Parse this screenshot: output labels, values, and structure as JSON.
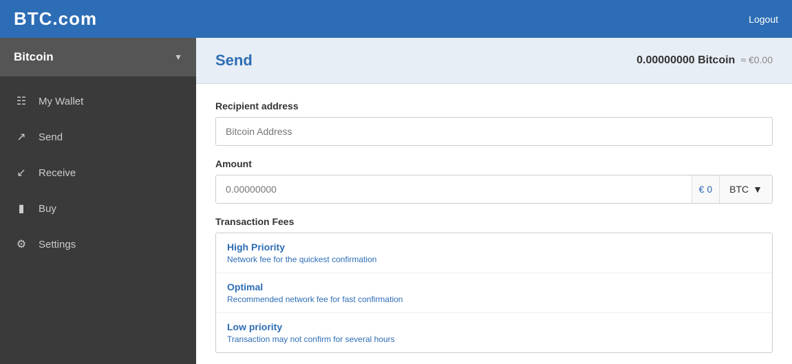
{
  "header": {
    "logo": "BTC.com",
    "logout_label": "Logout"
  },
  "sidebar": {
    "currency_label": "Bitcoin",
    "nav_items": [
      {
        "id": "my-wallet",
        "icon": "≡",
        "label": "My Wallet"
      },
      {
        "id": "send",
        "icon": "↗",
        "label": "Send"
      },
      {
        "id": "receive",
        "icon": "↙",
        "label": "Receive"
      },
      {
        "id": "buy",
        "icon": "▬",
        "label": "Buy"
      },
      {
        "id": "settings",
        "icon": "⚙",
        "label": "Settings"
      }
    ]
  },
  "main": {
    "page_title": "Send",
    "balance": {
      "amount": "0.00000000 Bitcoin",
      "approx": "≈ €0.00"
    },
    "recipient_label": "Recipient address",
    "recipient_placeholder": "Bitcoin Address",
    "amount_label": "Amount",
    "amount_placeholder": "0.00000000",
    "amount_euro": "€ 0",
    "currency_selector": "BTC",
    "fees_label": "Transaction Fees",
    "fees": [
      {
        "name": "High Priority",
        "desc": "Network fee for the quickest confirmation"
      },
      {
        "name": "Optimal",
        "desc": "Recommended network fee for fast confirmation"
      },
      {
        "name": "Low priority",
        "desc": "Transaction may not confirm for several hours"
      }
    ]
  }
}
